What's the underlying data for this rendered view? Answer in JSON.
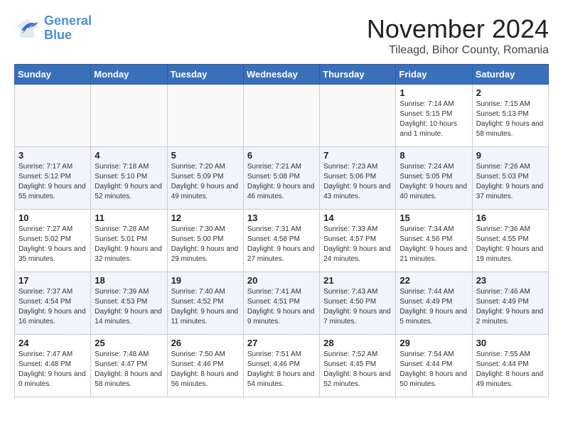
{
  "header": {
    "logo_line1": "General",
    "logo_line2": "Blue",
    "month_year": "November 2024",
    "location": "Tileagd, Bihor County, Romania"
  },
  "weekdays": [
    "Sunday",
    "Monday",
    "Tuesday",
    "Wednesday",
    "Thursday",
    "Friday",
    "Saturday"
  ],
  "weeks": [
    [
      {
        "day": "",
        "info": ""
      },
      {
        "day": "",
        "info": ""
      },
      {
        "day": "",
        "info": ""
      },
      {
        "day": "",
        "info": ""
      },
      {
        "day": "",
        "info": ""
      },
      {
        "day": "1",
        "info": "Sunrise: 7:14 AM\nSunset: 5:15 PM\nDaylight: 10 hours and 1 minute."
      },
      {
        "day": "2",
        "info": "Sunrise: 7:15 AM\nSunset: 5:13 PM\nDaylight: 9 hours and 58 minutes."
      }
    ],
    [
      {
        "day": "3",
        "info": "Sunrise: 7:17 AM\nSunset: 5:12 PM\nDaylight: 9 hours and 55 minutes."
      },
      {
        "day": "4",
        "info": "Sunrise: 7:18 AM\nSunset: 5:10 PM\nDaylight: 9 hours and 52 minutes."
      },
      {
        "day": "5",
        "info": "Sunrise: 7:20 AM\nSunset: 5:09 PM\nDaylight: 9 hours and 49 minutes."
      },
      {
        "day": "6",
        "info": "Sunrise: 7:21 AM\nSunset: 5:08 PM\nDaylight: 9 hours and 46 minutes."
      },
      {
        "day": "7",
        "info": "Sunrise: 7:23 AM\nSunset: 5:06 PM\nDaylight: 9 hours and 43 minutes."
      },
      {
        "day": "8",
        "info": "Sunrise: 7:24 AM\nSunset: 5:05 PM\nDaylight: 9 hours and 40 minutes."
      },
      {
        "day": "9",
        "info": "Sunrise: 7:26 AM\nSunset: 5:03 PM\nDaylight: 9 hours and 37 minutes."
      }
    ],
    [
      {
        "day": "10",
        "info": "Sunrise: 7:27 AM\nSunset: 5:02 PM\nDaylight: 9 hours and 35 minutes."
      },
      {
        "day": "11",
        "info": "Sunrise: 7:28 AM\nSunset: 5:01 PM\nDaylight: 9 hours and 32 minutes."
      },
      {
        "day": "12",
        "info": "Sunrise: 7:30 AM\nSunset: 5:00 PM\nDaylight: 9 hours and 29 minutes."
      },
      {
        "day": "13",
        "info": "Sunrise: 7:31 AM\nSunset: 4:58 PM\nDaylight: 9 hours and 27 minutes."
      },
      {
        "day": "14",
        "info": "Sunrise: 7:33 AM\nSunset: 4:57 PM\nDaylight: 9 hours and 24 minutes."
      },
      {
        "day": "15",
        "info": "Sunrise: 7:34 AM\nSunset: 4:56 PM\nDaylight: 9 hours and 21 minutes."
      },
      {
        "day": "16",
        "info": "Sunrise: 7:36 AM\nSunset: 4:55 PM\nDaylight: 9 hours and 19 minutes."
      }
    ],
    [
      {
        "day": "17",
        "info": "Sunrise: 7:37 AM\nSunset: 4:54 PM\nDaylight: 9 hours and 16 minutes."
      },
      {
        "day": "18",
        "info": "Sunrise: 7:39 AM\nSunset: 4:53 PM\nDaylight: 9 hours and 14 minutes."
      },
      {
        "day": "19",
        "info": "Sunrise: 7:40 AM\nSunset: 4:52 PM\nDaylight: 9 hours and 11 minutes."
      },
      {
        "day": "20",
        "info": "Sunrise: 7:41 AM\nSunset: 4:51 PM\nDaylight: 9 hours and 9 minutes."
      },
      {
        "day": "21",
        "info": "Sunrise: 7:43 AM\nSunset: 4:50 PM\nDaylight: 9 hours and 7 minutes."
      },
      {
        "day": "22",
        "info": "Sunrise: 7:44 AM\nSunset: 4:49 PM\nDaylight: 9 hours and 5 minutes."
      },
      {
        "day": "23",
        "info": "Sunrise: 7:46 AM\nSunset: 4:49 PM\nDaylight: 9 hours and 2 minutes."
      }
    ],
    [
      {
        "day": "24",
        "info": "Sunrise: 7:47 AM\nSunset: 4:48 PM\nDaylight: 9 hours and 0 minutes."
      },
      {
        "day": "25",
        "info": "Sunrise: 7:48 AM\nSunset: 4:47 PM\nDaylight: 8 hours and 58 minutes."
      },
      {
        "day": "26",
        "info": "Sunrise: 7:50 AM\nSunset: 4:46 PM\nDaylight: 8 hours and 56 minutes."
      },
      {
        "day": "27",
        "info": "Sunrise: 7:51 AM\nSunset: 4:46 PM\nDaylight: 8 hours and 54 minutes."
      },
      {
        "day": "28",
        "info": "Sunrise: 7:52 AM\nSunset: 4:45 PM\nDaylight: 8 hours and 52 minutes."
      },
      {
        "day": "29",
        "info": "Sunrise: 7:54 AM\nSunset: 4:44 PM\nDaylight: 8 hours and 50 minutes."
      },
      {
        "day": "30",
        "info": "Sunrise: 7:55 AM\nSunset: 4:44 PM\nDaylight: 8 hours and 49 minutes."
      }
    ]
  ]
}
